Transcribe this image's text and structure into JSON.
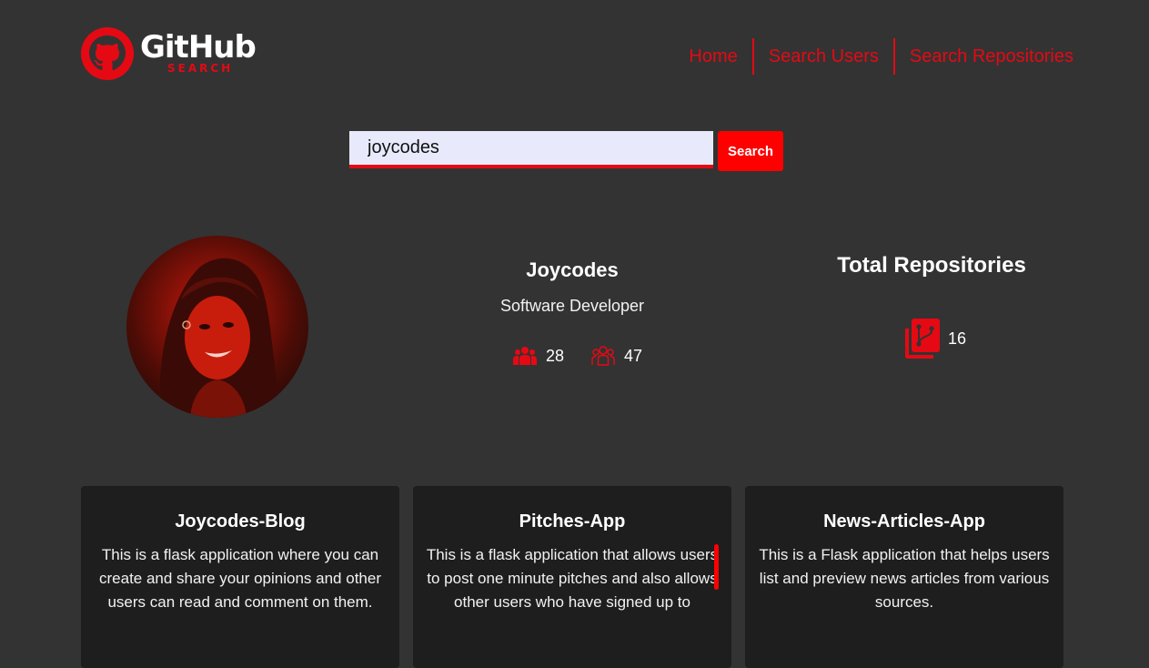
{
  "brand": {
    "name": "GitHub",
    "tagline": "SEARCH",
    "accent": "#e50914"
  },
  "nav": {
    "items": [
      "Home",
      "Search Users",
      "Search Repositories"
    ]
  },
  "search": {
    "value": "joycodes",
    "button_label": "Search"
  },
  "profile": {
    "name": "Joycodes",
    "bio": "Software Developer",
    "followers": "28",
    "following": "47"
  },
  "repos": {
    "title": "Total Repositories",
    "count": "16"
  },
  "cards": [
    {
      "title": "Joycodes-Blog",
      "description": "This is a flask application where you can create and share your opinions and other users can read and comment on them."
    },
    {
      "title": "Pitches-App",
      "description": "This is a flask application that allows users to post one minute pitches and also allows other users who have signed up to"
    },
    {
      "title": "News-Articles-App",
      "description": "This is a Flask application that helps users list and preview news articles from various sources."
    }
  ]
}
